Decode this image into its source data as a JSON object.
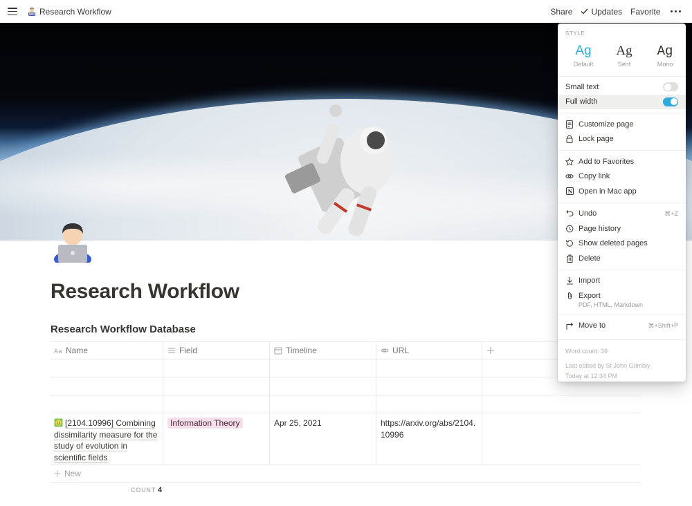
{
  "topbar": {
    "page_title": "Research Workflow",
    "actions": {
      "share": "Share",
      "updates": "Updates",
      "favorite": "Favorite"
    }
  },
  "page": {
    "title": "Research Workflow",
    "database_title": "Research Workflow Database"
  },
  "table": {
    "columns": [
      {
        "label": "Name",
        "icon": "text-icon"
      },
      {
        "label": "Field",
        "icon": "list-icon"
      },
      {
        "label": "Timeline",
        "icon": "calendar-icon"
      },
      {
        "label": "URL",
        "icon": "link-icon"
      }
    ],
    "row": {
      "name": "[2104.10996] Combining dissimilarity measure for the study of evolution in scientific fields",
      "field": "Information Theory",
      "timeline": "Apr 25, 2021",
      "url": "https://arxiv.org/abs/2104.10996"
    },
    "new_label": "New",
    "count_label": "COUNT",
    "count_value": "4"
  },
  "menu": {
    "style_label": "STYLE",
    "styles": [
      {
        "glyph": "Ag",
        "label": "Default"
      },
      {
        "glyph": "Ag",
        "label": "Serif"
      },
      {
        "glyph": "Ag",
        "label": "Mono"
      }
    ],
    "small_text": "Small text",
    "full_width": "Full width",
    "customize_page": "Customize page",
    "lock_page": "Lock page",
    "add_to_favorites": "Add to Favorites",
    "copy_link": "Copy link",
    "open_in_mac_app": "Open in Mac app",
    "undo": "Undo",
    "undo_shortcut": "⌘+Z",
    "page_history": "Page history",
    "show_deleted_pages": "Show deleted pages",
    "delete": "Delete",
    "import": "Import",
    "export": "Export",
    "export_formats": "PDF, HTML, Markdown",
    "move_to": "Move to",
    "move_to_shortcut": "⌘+Shift+P",
    "word_count": "Word count: 39",
    "last_edited": "Last edited by St John Grimbly",
    "edited_time": "Today at 12:34 PM"
  },
  "colors": {
    "accent": "#2eaadc",
    "tag_bg": "#f5e0e9",
    "text": "#37352f"
  }
}
